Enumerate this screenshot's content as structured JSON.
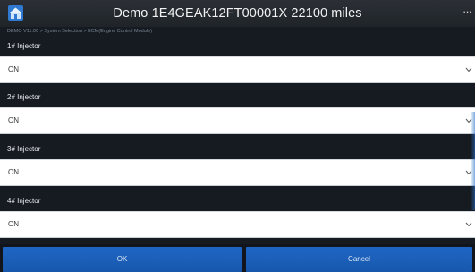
{
  "header": {
    "title": "Demo  1E4GEAK12FT00001X  22100 miles",
    "home_icon": "home-icon",
    "more_icon": "more-icon",
    "more_glyph": "···"
  },
  "breadcrumb": "DEMO V11.00 > System Selection > ECM(Engine Control Module)",
  "injectors": [
    {
      "label": "1# Injector",
      "value": "ON"
    },
    {
      "label": "2# Injector",
      "value": "ON"
    },
    {
      "label": "3# Injector",
      "value": "ON"
    },
    {
      "label": "4# Injector",
      "value": "ON"
    }
  ],
  "buttons": {
    "ok": "OK",
    "cancel": "Cancel"
  },
  "colors": {
    "accent": "#1f66c4",
    "header": "#2b3036",
    "background": "#161b22"
  }
}
